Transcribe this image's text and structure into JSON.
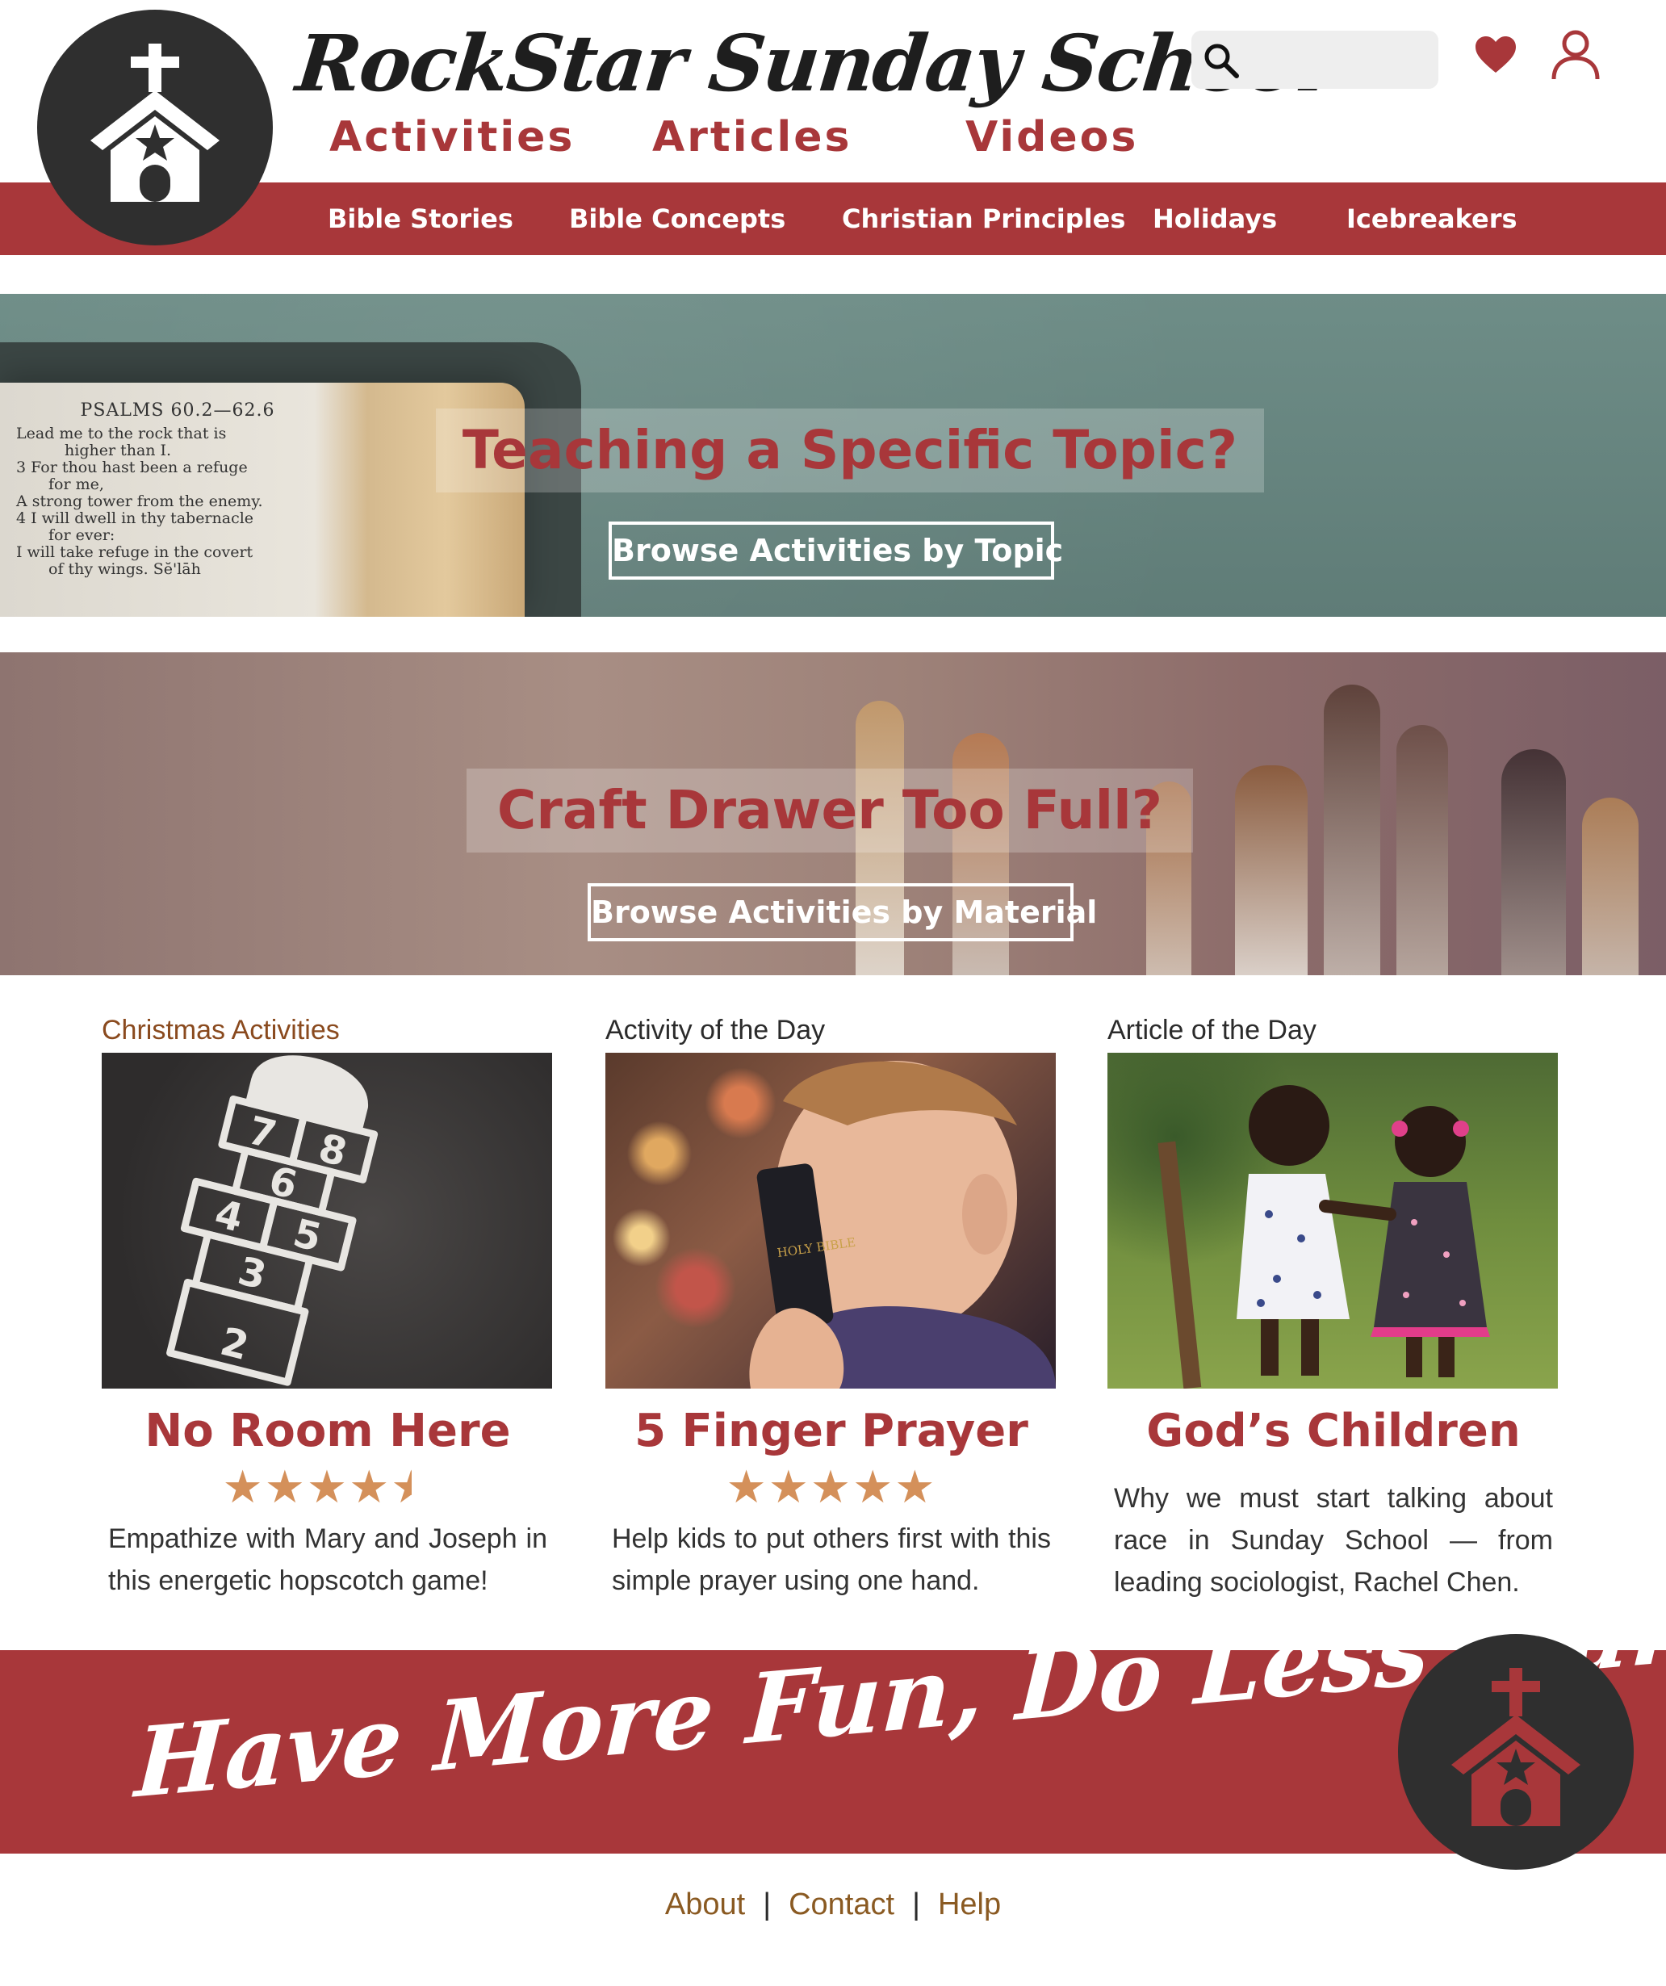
{
  "header": {
    "site_title": "RockStar Sunday School",
    "main_nav": [
      "Activities",
      "Articles",
      "Videos"
    ],
    "search": {
      "placeholder": ""
    },
    "categories": [
      "Bible Stories",
      "Bible Concepts",
      "Christian Principles",
      "Holidays",
      "Icebreakers"
    ]
  },
  "banners": {
    "topic": {
      "headline": "Teaching a Specific Topic?",
      "button": "Browse Activities by Topic",
      "bible_ref": "PSALMS 60.2—62.6",
      "bible_lines": [
        "Lead me to the rock that is",
        "higher than I.",
        "3 For thou hast been a refuge",
        "for me,",
        "A strong tower from the enemy.",
        "4 I will dwell in thy tabernacle",
        "for ever:",
        "I will take refuge in the covert",
        "of thy wings.   Sĕ'lāh"
      ]
    },
    "material": {
      "headline": "Craft Drawer Too Full?",
      "button": "Browse Activities by Material"
    }
  },
  "cards": [
    {
      "kicker": "Christmas Activities",
      "title": "No Room Here",
      "rating": 4.5,
      "description": "Empathize with Mary and Joseph in this energetic hopscotch game!",
      "kicker_color": "#8a4a1e"
    },
    {
      "kicker": "Activity of the Day",
      "title": "5 Finger Prayer",
      "rating": 5,
      "description": "Help kids to put others first with this simple prayer using one hand.",
      "book_label": "HOLY BIBLE"
    },
    {
      "kicker": "Article of the Day",
      "title": "God’s Children",
      "description": "Why we must start talking about race in Sunday School — from leading sociologist, Rachel Chen."
    }
  ],
  "hopscotch_numbers": [
    "8",
    "7",
    "6",
    "5",
    "4",
    "3",
    "2"
  ],
  "footer": {
    "slogan": "Have More Fun, Do Less Planning",
    "links": [
      "About",
      "Contact",
      "Help"
    ]
  },
  "colors": {
    "brand_red": "#a8373a",
    "dark": "#2f2f2f",
    "star": "#d4905a",
    "link_brown": "#8a5a22"
  },
  "icons": {
    "logo": "church-icon",
    "search": "search-icon",
    "favorite": "heart-icon",
    "account": "user-icon"
  }
}
